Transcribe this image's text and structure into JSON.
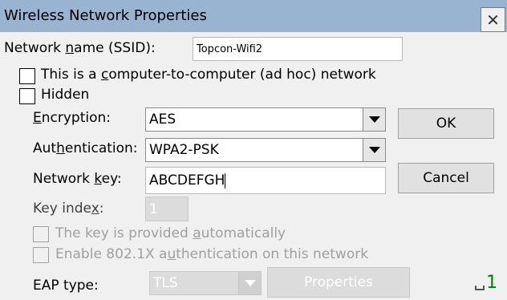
{
  "window": {
    "title": "Wireless Network Properties",
    "close_glyph": "✕"
  },
  "ssid": {
    "label_pre": "Network ",
    "label_key": "n",
    "label_post": "ame (SSID):",
    "value": "Topcon-Wifi2"
  },
  "adhoc": {
    "label_pre": "This is a ",
    "label_key": "c",
    "label_post": "omputer-to-computer (ad hoc) network",
    "checked": false
  },
  "hidden": {
    "label": "Hidden",
    "checked": false
  },
  "encryption": {
    "label_key": "E",
    "label_post": "ncryption:",
    "value": "AES"
  },
  "authentication": {
    "label_pre": "Aut",
    "label_key": "h",
    "label_post": "entication:",
    "value": "WPA2-PSK"
  },
  "network_key": {
    "label_pre": "Network ",
    "label_key": "k",
    "label_post": "ey:",
    "value": "ABCDEFGH"
  },
  "key_index": {
    "label_pre": "Key inde",
    "label_key": "x",
    "label_post": ":",
    "value": "1"
  },
  "auto_key": {
    "label_pre": "The key is provided ",
    "label_key": "a",
    "label_post": "utomatically",
    "checked": false
  },
  "dot1x": {
    "label_pre": "Enable 802.1X a",
    "label_key": "u",
    "label_post": "thentication on this network",
    "checked": false
  },
  "eap": {
    "label": "EAP type:",
    "value": "TLS",
    "properties_label": "Properties"
  },
  "buttons": {
    "ok": "OK",
    "cancel": "Cancel"
  },
  "status": {
    "indicator": "1",
    "indicator_color": "#008000"
  }
}
